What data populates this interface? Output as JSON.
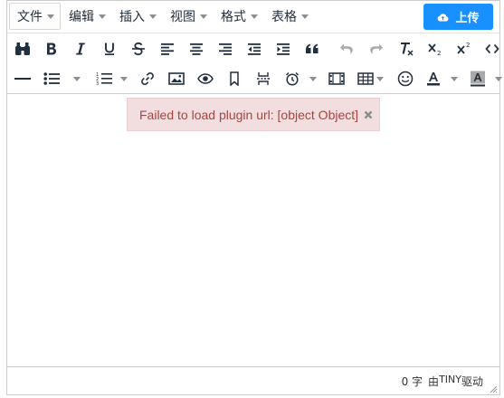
{
  "menubar": {
    "items": [
      {
        "label": "文件"
      },
      {
        "label": "编辑"
      },
      {
        "label": "插入"
      },
      {
        "label": "视图"
      },
      {
        "label": "格式"
      },
      {
        "label": "表格"
      }
    ]
  },
  "upload_button": {
    "label": "上传",
    "color": "#1890ff"
  },
  "toolbar": {
    "row1_icons": [
      "binoculars-icon",
      "bold-icon",
      "italic-icon",
      "underline-icon",
      "strikethrough-icon",
      "align-left-icon",
      "align-center-icon",
      "align-right-icon",
      "outdent-icon",
      "indent-icon",
      "blockquote-icon",
      "undo-icon",
      "redo-icon",
      "remove-format-icon",
      "subscript-icon",
      "superscript-icon",
      "code-icon"
    ],
    "row2_icons": [
      "horizontal-rule-icon",
      "bullet-list-icon",
      "numbered-list-icon",
      "link-icon",
      "image-icon",
      "preview-icon",
      "bookmark-icon",
      "page-break-icon",
      "insert-datetime-icon",
      "media-icon",
      "table-icon",
      "emoticons-icon",
      "text-color-icon",
      "background-color-icon"
    ]
  },
  "notification": {
    "message": "Failed to load plugin url: [object Object]",
    "background": "#f2dede",
    "text_color": "#a94442"
  },
  "statusbar": {
    "wordcount": "0 字",
    "branding_prefix": "由",
    "branding_name": "TINY",
    "branding_suffix": "驱动"
  }
}
